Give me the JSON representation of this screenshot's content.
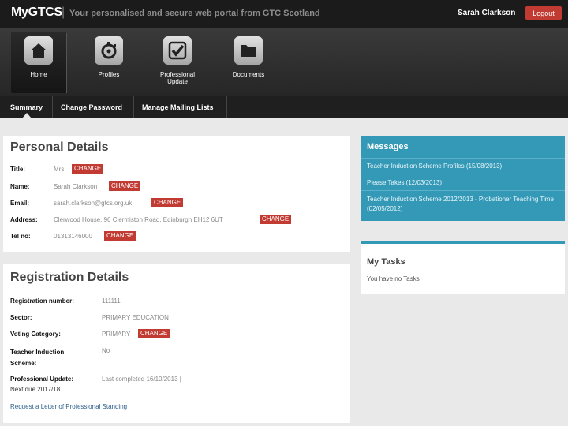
{
  "header": {
    "logo": "MyGTCS",
    "separator": "|",
    "tagline": "Your personalised and secure web portal from GTC Scotland",
    "user_name": "Sarah Clarkson",
    "logout_label": "Logout"
  },
  "icon_nav": [
    {
      "label": "Home",
      "icon": "home-icon"
    },
    {
      "label": "Profiles",
      "icon": "stopwatch-icon"
    },
    {
      "label": "Professional Update",
      "icon": "checkmark-icon"
    },
    {
      "label": "Documents",
      "icon": "folder-icon"
    }
  ],
  "sub_nav": [
    "Summary",
    "Change Password",
    "Manage Mailing Lists"
  ],
  "personal_details": {
    "title": "Personal Details",
    "rows": [
      {
        "label": "Title:",
        "value": "Mrs",
        "action": "CHANGE"
      },
      {
        "label": "Name:",
        "value": "Sarah Clarkson",
        "action": "CHANGE"
      },
      {
        "label": "Email:",
        "value": "sarah.clarkson@gtcs.org.uk",
        "action": "CHANGE"
      },
      {
        "label": "Address:",
        "value": "Clerwood House, 96 Clermiston Road, Edinburgh EH12 6UT",
        "action": "CHANGE"
      },
      {
        "label": "Tel no:",
        "value": "01313146000",
        "action": "CHANGE"
      }
    ]
  },
  "registration_details": {
    "title": "Registration Details",
    "rows": [
      {
        "label": "Registration number:",
        "value": "111111"
      },
      {
        "label": "Sector:",
        "value": "PRIMARY EDUCATION"
      },
      {
        "label": "Voting Category:",
        "value": "PRIMARY",
        "action": "CHANGE"
      },
      {
        "label": "Teacher Induction Scheme:",
        "value": "No"
      },
      {
        "label": "Professional Update:",
        "sub_label": "Next due 2017/18",
        "value": "Last completed 16/10/2013 |"
      }
    ],
    "link": "Request a Letter of Professional Standing"
  },
  "messages": {
    "title": "Messages",
    "items": [
      "Teacher Induction Scheme Profiles (15/08/2013)",
      "Please Takes (12/03/2013)",
      "Teacher Induction Scheme 2012/2013 - Probationer Teaching Time (02/05/2012)"
    ]
  },
  "tasks": {
    "title": "My Tasks",
    "empty_text": "You have no Tasks"
  },
  "colors": {
    "accent_red": "#c23b33",
    "accent_blue": "#3399b7",
    "header_bg": "#1b1b1b"
  }
}
